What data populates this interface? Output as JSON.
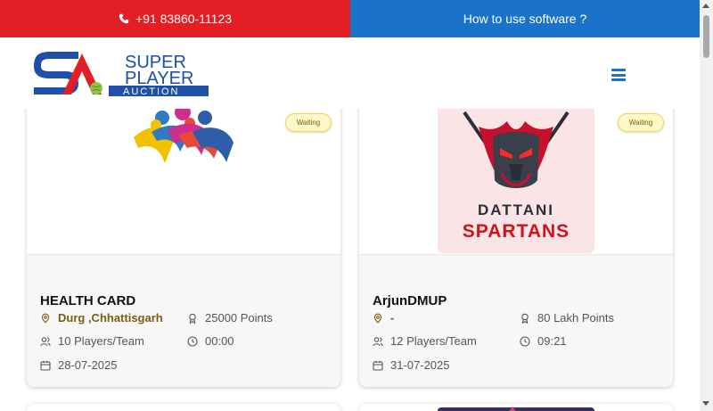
{
  "topbar": {
    "phone": "+91 83860-11123",
    "help_link": "How to use software ?"
  },
  "logo": {
    "line1": "SUPER",
    "line2": "PLAYER",
    "line3": "AUCTION"
  },
  "colors": {
    "red": "#e31e24",
    "blue": "#1a73c9",
    "badge_bg": "#fff8c8",
    "location_text": "#7a5e12"
  },
  "cards": [
    {
      "status": "Waiting",
      "name": "HEALTH CARD",
      "location": "Durg ,Chhattisgarh",
      "points": "25000 Points",
      "players": "10 Players/Team",
      "time": "00:00",
      "date": "28-07-2025"
    },
    {
      "status": "Waiting",
      "name": "ArjunDMUP",
      "location": "-",
      "points": "80 Lakh Points",
      "players": "12 Players/Team",
      "time": "09:21",
      "date": "31-07-2025",
      "logo_text_top": "DATTANI",
      "logo_text_bottom": "SPARTANS"
    }
  ]
}
